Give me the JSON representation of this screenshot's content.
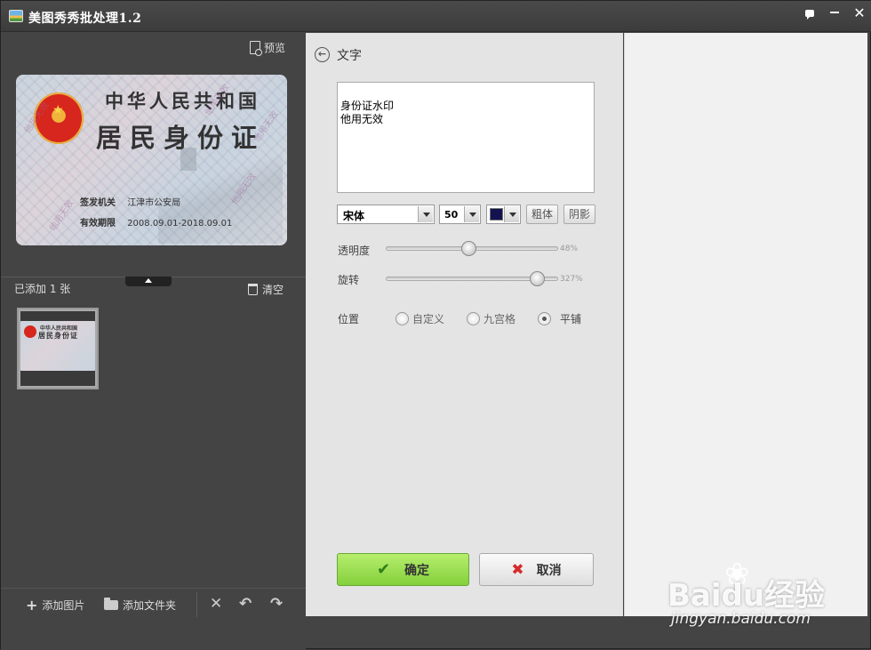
{
  "window": {
    "title": "美图秀秀批处理1.2"
  },
  "titlebar": {
    "feedback_icon": "feedback-icon",
    "minimize_icon": "minimize-icon",
    "close_glyph": "✕"
  },
  "left_panel": {
    "preview_label": "预览",
    "main_image": {
      "title_line1": "中华人民共和国",
      "title_line2": "居民身份证",
      "authority_label": "签发机关",
      "authority_value": "江津市公安局",
      "validity_label": "有效期限",
      "validity_value": "2008.09.01-2018.09.01",
      "watermark_text": "他用无效"
    },
    "added_count": "已添加 1 张",
    "clear_label": "清空",
    "bottom": {
      "add_image": "添加图片",
      "add_folder": "添加文件夹"
    }
  },
  "settings": {
    "title": "文字",
    "text_value": "身份证水印\n他用无效",
    "font": "宋体",
    "font_size": "50",
    "text_color": "#14124e",
    "bold_label": "粗体",
    "shadow_label": "阴影",
    "opacity": {
      "label": "透明度",
      "value": "48%",
      "fraction": 0.48
    },
    "rotation": {
      "label": "旋转",
      "value": "327%",
      "fraction": 0.88
    },
    "position": {
      "label": "位置",
      "options": [
        {
          "label": "自定义",
          "selected": false
        },
        {
          "label": "九宫格",
          "selected": false
        },
        {
          "label": "平铺",
          "selected": true
        }
      ]
    },
    "ok_label": "确定",
    "cancel_label": "取消"
  },
  "watermark_overlay": {
    "logo": "Baidu经验",
    "url": "jingyan.baidu.com"
  }
}
